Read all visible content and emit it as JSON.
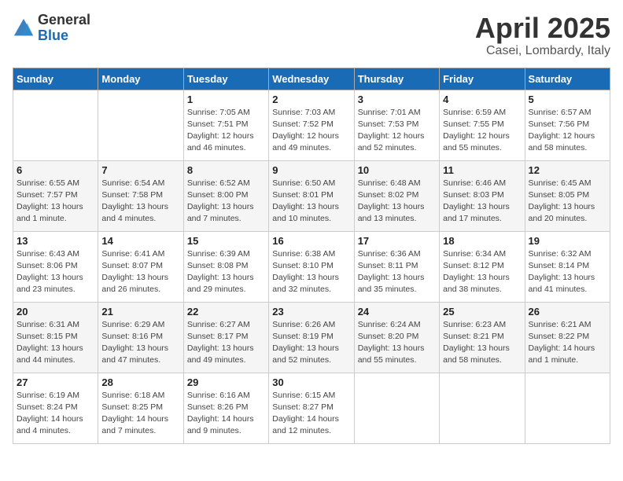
{
  "logo": {
    "general": "General",
    "blue": "Blue"
  },
  "title": "April 2025",
  "location": "Casei, Lombardy, Italy",
  "days_of_week": [
    "Sunday",
    "Monday",
    "Tuesday",
    "Wednesday",
    "Thursday",
    "Friday",
    "Saturday"
  ],
  "weeks": [
    [
      {
        "day": "",
        "info": ""
      },
      {
        "day": "",
        "info": ""
      },
      {
        "day": "1",
        "sunrise": "Sunrise: 7:05 AM",
        "sunset": "Sunset: 7:51 PM",
        "daylight": "Daylight: 12 hours and 46 minutes."
      },
      {
        "day": "2",
        "sunrise": "Sunrise: 7:03 AM",
        "sunset": "Sunset: 7:52 PM",
        "daylight": "Daylight: 12 hours and 49 minutes."
      },
      {
        "day": "3",
        "sunrise": "Sunrise: 7:01 AM",
        "sunset": "Sunset: 7:53 PM",
        "daylight": "Daylight: 12 hours and 52 minutes."
      },
      {
        "day": "4",
        "sunrise": "Sunrise: 6:59 AM",
        "sunset": "Sunset: 7:55 PM",
        "daylight": "Daylight: 12 hours and 55 minutes."
      },
      {
        "day": "5",
        "sunrise": "Sunrise: 6:57 AM",
        "sunset": "Sunset: 7:56 PM",
        "daylight": "Daylight: 12 hours and 58 minutes."
      }
    ],
    [
      {
        "day": "6",
        "sunrise": "Sunrise: 6:55 AM",
        "sunset": "Sunset: 7:57 PM",
        "daylight": "Daylight: 13 hours and 1 minute."
      },
      {
        "day": "7",
        "sunrise": "Sunrise: 6:54 AM",
        "sunset": "Sunset: 7:58 PM",
        "daylight": "Daylight: 13 hours and 4 minutes."
      },
      {
        "day": "8",
        "sunrise": "Sunrise: 6:52 AM",
        "sunset": "Sunset: 8:00 PM",
        "daylight": "Daylight: 13 hours and 7 minutes."
      },
      {
        "day": "9",
        "sunrise": "Sunrise: 6:50 AM",
        "sunset": "Sunset: 8:01 PM",
        "daylight": "Daylight: 13 hours and 10 minutes."
      },
      {
        "day": "10",
        "sunrise": "Sunrise: 6:48 AM",
        "sunset": "Sunset: 8:02 PM",
        "daylight": "Daylight: 13 hours and 13 minutes."
      },
      {
        "day": "11",
        "sunrise": "Sunrise: 6:46 AM",
        "sunset": "Sunset: 8:03 PM",
        "daylight": "Daylight: 13 hours and 17 minutes."
      },
      {
        "day": "12",
        "sunrise": "Sunrise: 6:45 AM",
        "sunset": "Sunset: 8:05 PM",
        "daylight": "Daylight: 13 hours and 20 minutes."
      }
    ],
    [
      {
        "day": "13",
        "sunrise": "Sunrise: 6:43 AM",
        "sunset": "Sunset: 8:06 PM",
        "daylight": "Daylight: 13 hours and 23 minutes."
      },
      {
        "day": "14",
        "sunrise": "Sunrise: 6:41 AM",
        "sunset": "Sunset: 8:07 PM",
        "daylight": "Daylight: 13 hours and 26 minutes."
      },
      {
        "day": "15",
        "sunrise": "Sunrise: 6:39 AM",
        "sunset": "Sunset: 8:08 PM",
        "daylight": "Daylight: 13 hours and 29 minutes."
      },
      {
        "day": "16",
        "sunrise": "Sunrise: 6:38 AM",
        "sunset": "Sunset: 8:10 PM",
        "daylight": "Daylight: 13 hours and 32 minutes."
      },
      {
        "day": "17",
        "sunrise": "Sunrise: 6:36 AM",
        "sunset": "Sunset: 8:11 PM",
        "daylight": "Daylight: 13 hours and 35 minutes."
      },
      {
        "day": "18",
        "sunrise": "Sunrise: 6:34 AM",
        "sunset": "Sunset: 8:12 PM",
        "daylight": "Daylight: 13 hours and 38 minutes."
      },
      {
        "day": "19",
        "sunrise": "Sunrise: 6:32 AM",
        "sunset": "Sunset: 8:14 PM",
        "daylight": "Daylight: 13 hours and 41 minutes."
      }
    ],
    [
      {
        "day": "20",
        "sunrise": "Sunrise: 6:31 AM",
        "sunset": "Sunset: 8:15 PM",
        "daylight": "Daylight: 13 hours and 44 minutes."
      },
      {
        "day": "21",
        "sunrise": "Sunrise: 6:29 AM",
        "sunset": "Sunset: 8:16 PM",
        "daylight": "Daylight: 13 hours and 47 minutes."
      },
      {
        "day": "22",
        "sunrise": "Sunrise: 6:27 AM",
        "sunset": "Sunset: 8:17 PM",
        "daylight": "Daylight: 13 hours and 49 minutes."
      },
      {
        "day": "23",
        "sunrise": "Sunrise: 6:26 AM",
        "sunset": "Sunset: 8:19 PM",
        "daylight": "Daylight: 13 hours and 52 minutes."
      },
      {
        "day": "24",
        "sunrise": "Sunrise: 6:24 AM",
        "sunset": "Sunset: 8:20 PM",
        "daylight": "Daylight: 13 hours and 55 minutes."
      },
      {
        "day": "25",
        "sunrise": "Sunrise: 6:23 AM",
        "sunset": "Sunset: 8:21 PM",
        "daylight": "Daylight: 13 hours and 58 minutes."
      },
      {
        "day": "26",
        "sunrise": "Sunrise: 6:21 AM",
        "sunset": "Sunset: 8:22 PM",
        "daylight": "Daylight: 14 hours and 1 minute."
      }
    ],
    [
      {
        "day": "27",
        "sunrise": "Sunrise: 6:19 AM",
        "sunset": "Sunset: 8:24 PM",
        "daylight": "Daylight: 14 hours and 4 minutes."
      },
      {
        "day": "28",
        "sunrise": "Sunrise: 6:18 AM",
        "sunset": "Sunset: 8:25 PM",
        "daylight": "Daylight: 14 hours and 7 minutes."
      },
      {
        "day": "29",
        "sunrise": "Sunrise: 6:16 AM",
        "sunset": "Sunset: 8:26 PM",
        "daylight": "Daylight: 14 hours and 9 minutes."
      },
      {
        "day": "30",
        "sunrise": "Sunrise: 6:15 AM",
        "sunset": "Sunset: 8:27 PM",
        "daylight": "Daylight: 14 hours and 12 minutes."
      },
      {
        "day": "",
        "info": ""
      },
      {
        "day": "",
        "info": ""
      },
      {
        "day": "",
        "info": ""
      }
    ]
  ]
}
